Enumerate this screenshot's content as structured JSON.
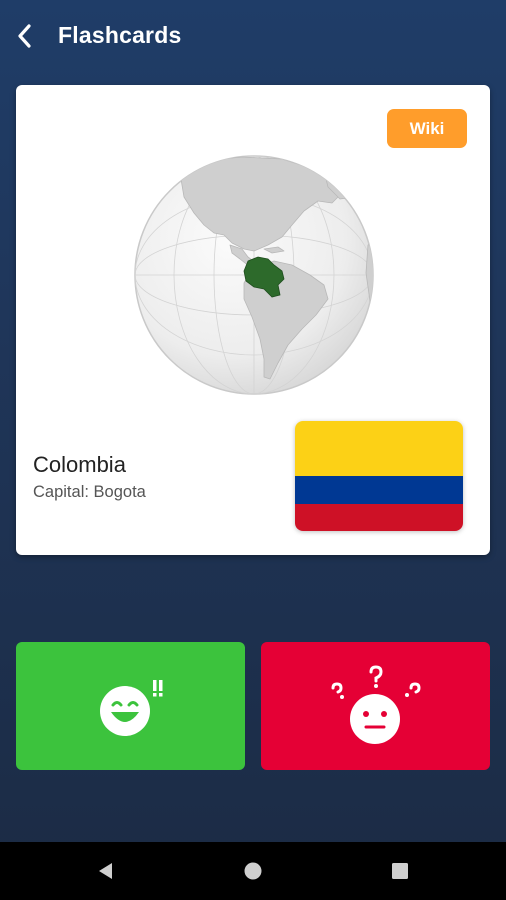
{
  "header": {
    "title": "Flashcards"
  },
  "card": {
    "wiki_label": "Wiki",
    "country_name": "Colombia",
    "capital_text": "Capital: Bogota",
    "flag_colors": [
      "#fcd116",
      "#003893",
      "#ce1126"
    ],
    "highlight_color": "#2d6a2b"
  },
  "answers": {
    "know_color": "#3cc33d",
    "dont_know_color": "#e50035"
  },
  "icons": {
    "back": "chevron-left-icon",
    "know": "laughing-face-icon",
    "dont_know": "confused-face-icon",
    "nav_back": "triangle-back-icon",
    "nav_home": "circle-home-icon",
    "nav_recents": "square-recents-icon"
  }
}
